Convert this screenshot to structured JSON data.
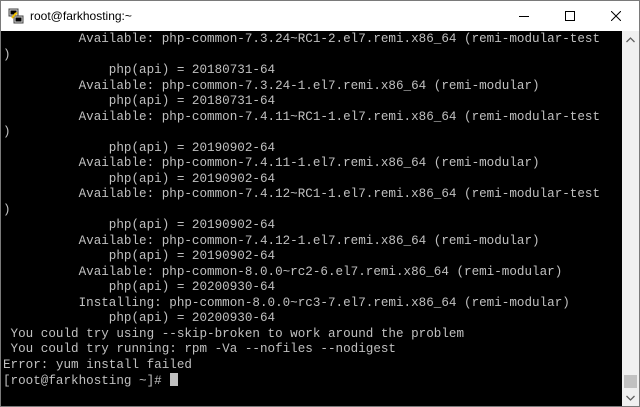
{
  "window": {
    "title": "root@farkhosting:~",
    "app_icon": "putty-icon",
    "controls": [
      "minimize-icon",
      "maximize-icon",
      "close-icon"
    ]
  },
  "terminal": {
    "background": "#000000",
    "foreground": "#c0c0c0",
    "lines": [
      "          Available: php-common-7.3.24~RC1-2.el7.remi.x86_64 (remi-modular-test",
      ")",
      "              php(api) = 20180731-64",
      "          Available: php-common-7.3.24-1.el7.remi.x86_64 (remi-modular)",
      "              php(api) = 20180731-64",
      "          Available: php-common-7.4.11~RC1-1.el7.remi.x86_64 (remi-modular-test",
      ")",
      "              php(api) = 20190902-64",
      "          Available: php-common-7.4.11-1.el7.remi.x86_64 (remi-modular)",
      "              php(api) = 20190902-64",
      "          Available: php-common-7.4.12~RC1-1.el7.remi.x86_64 (remi-modular-test",
      ")",
      "              php(api) = 20190902-64",
      "          Available: php-common-7.4.12-1.el7.remi.x86_64 (remi-modular)",
      "              php(api) = 20190902-64",
      "          Available: php-common-8.0.0~rc2-6.el7.remi.x86_64 (remi-modular)",
      "              php(api) = 20200930-64",
      "          Installing: php-common-8.0.0~rc3-7.el7.remi.x86_64 (remi-modular)",
      "              php(api) = 20200930-64",
      " You could try using --skip-broken to work around the problem",
      " You could try running: rpm -Va --nofiles --nodigest",
      "Error: yum install failed"
    ],
    "prompt": "[root@farkhosting ~]# "
  },
  "scrollbar": {
    "up_icon": "scroll-up-arrow-icon",
    "down_icon": "scroll-down-arrow-icon"
  }
}
